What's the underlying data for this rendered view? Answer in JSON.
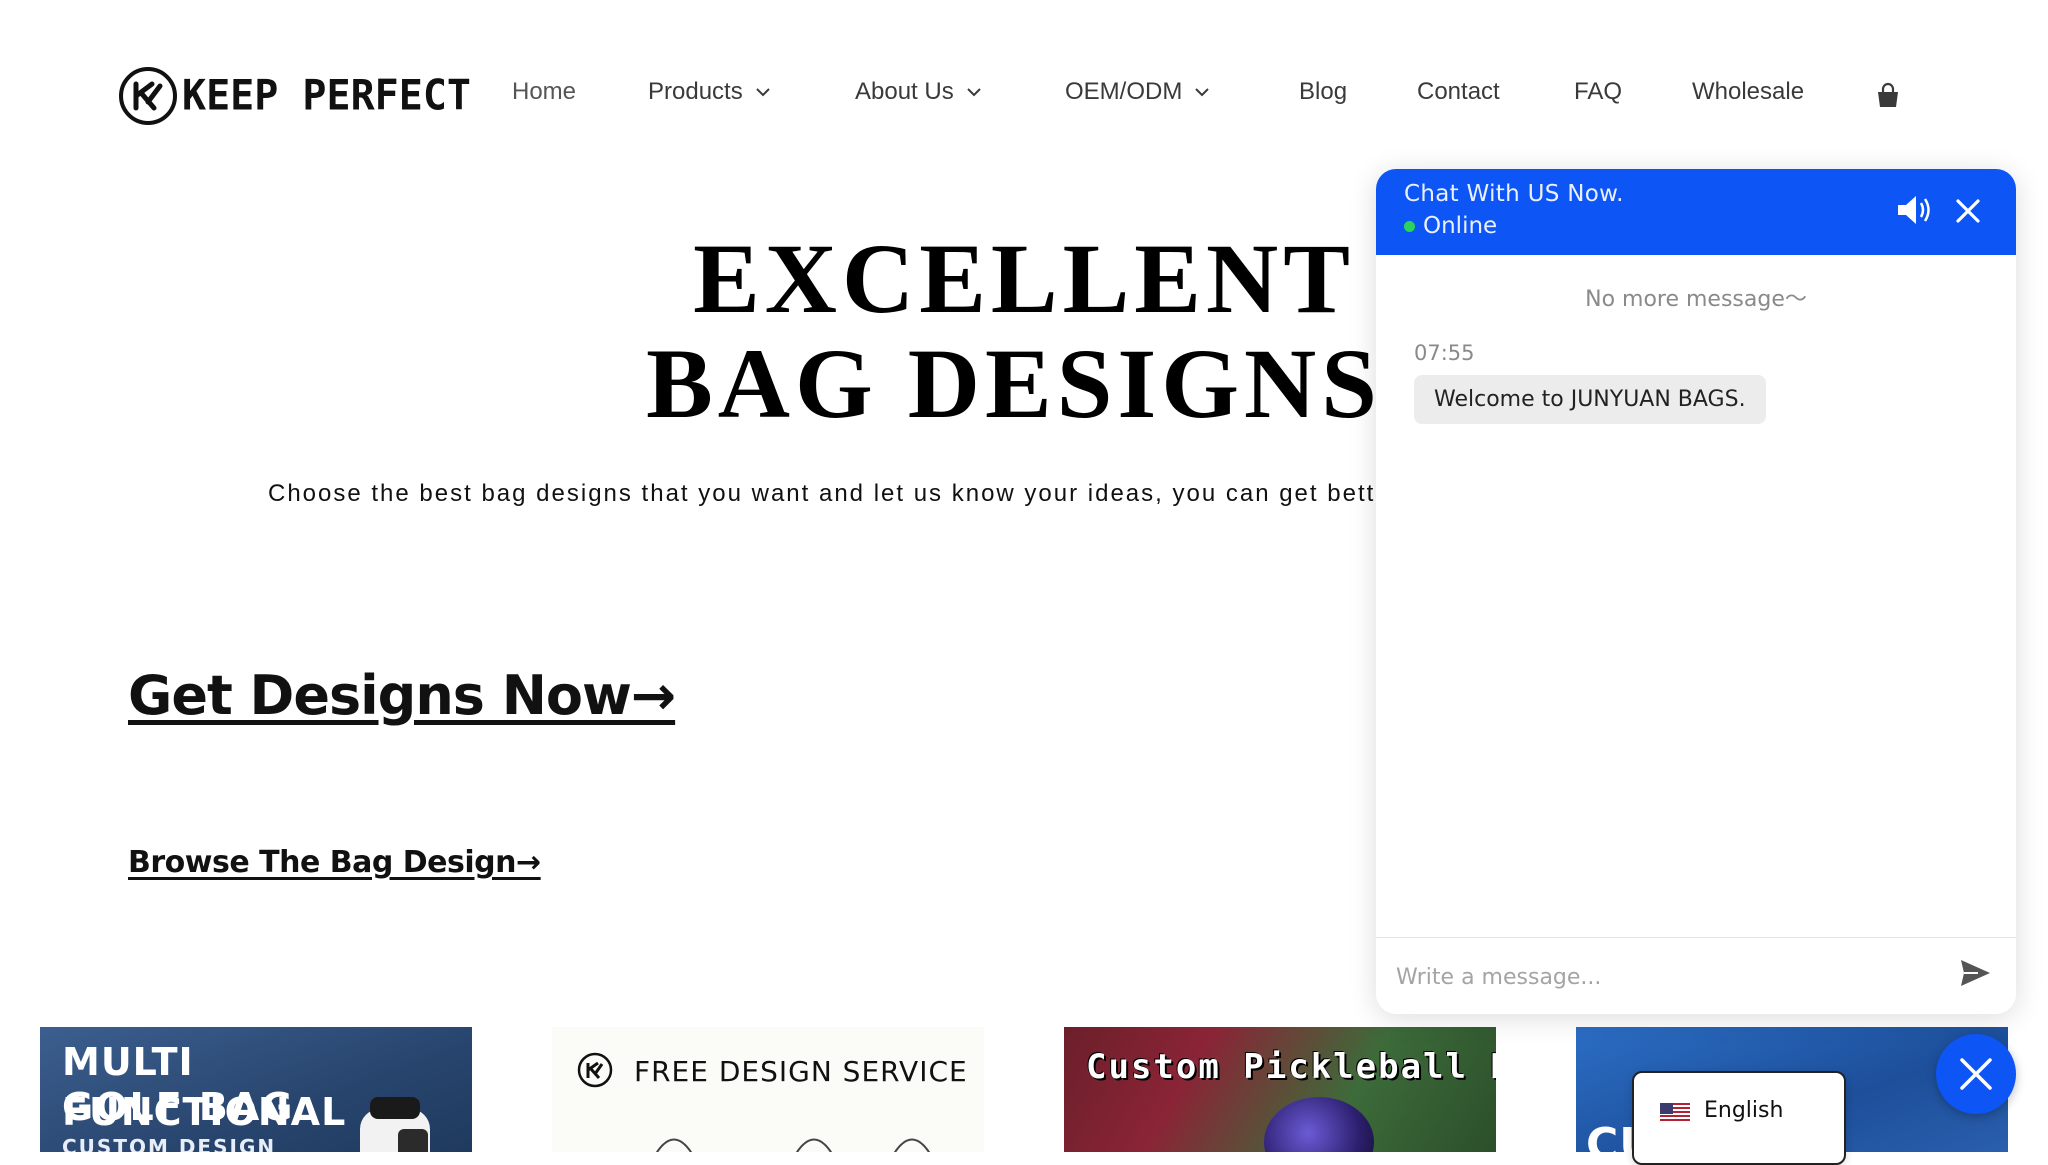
{
  "header": {
    "logo_text": "KEEP PERFECT",
    "nav": [
      {
        "label": "Home",
        "dropdown": false
      },
      {
        "label": "Products",
        "dropdown": true
      },
      {
        "label": "About Us",
        "dropdown": true
      },
      {
        "label": "OEM/ODM",
        "dropdown": true
      },
      {
        "label": "Blog",
        "dropdown": false
      },
      {
        "label": "Contact",
        "dropdown": false
      },
      {
        "label": "FAQ",
        "dropdown": false
      },
      {
        "label": "Wholesale",
        "dropdown": false
      }
    ],
    "cart_icon": "shopping-bag-icon"
  },
  "hero": {
    "title_line1": "EXCELLENT",
    "title_line2": "BAG DESIGNS",
    "subtitle": "Choose the best bag designs that you want and let us know your ideas, you can get bette",
    "cta_primary": "Get Designs Now→",
    "cta_secondary": "Browse The Bag Design→"
  },
  "tiles": [
    {
      "line1": "MULTI FUNCTIONAL",
      "line2": "GOLF BAG",
      "line3": "CUSTOM DESIGN"
    },
    {
      "line1": "FREE DESIGN SERVICE"
    },
    {
      "line1": "Custom Pickleball Bag"
    },
    {
      "line1": "CU"
    }
  ],
  "chat": {
    "title": "Chat With US Now.",
    "status": "Online",
    "no_more": "No more message～",
    "message_time": "07:55",
    "message_text": "Welcome to JUNYUAN BAGS.",
    "input_placeholder": "Write a message...",
    "accent_color": "#0d55f5",
    "online_color": "#2cd35a"
  },
  "language": {
    "label": "English",
    "flag_icon": "us-flag-icon"
  }
}
